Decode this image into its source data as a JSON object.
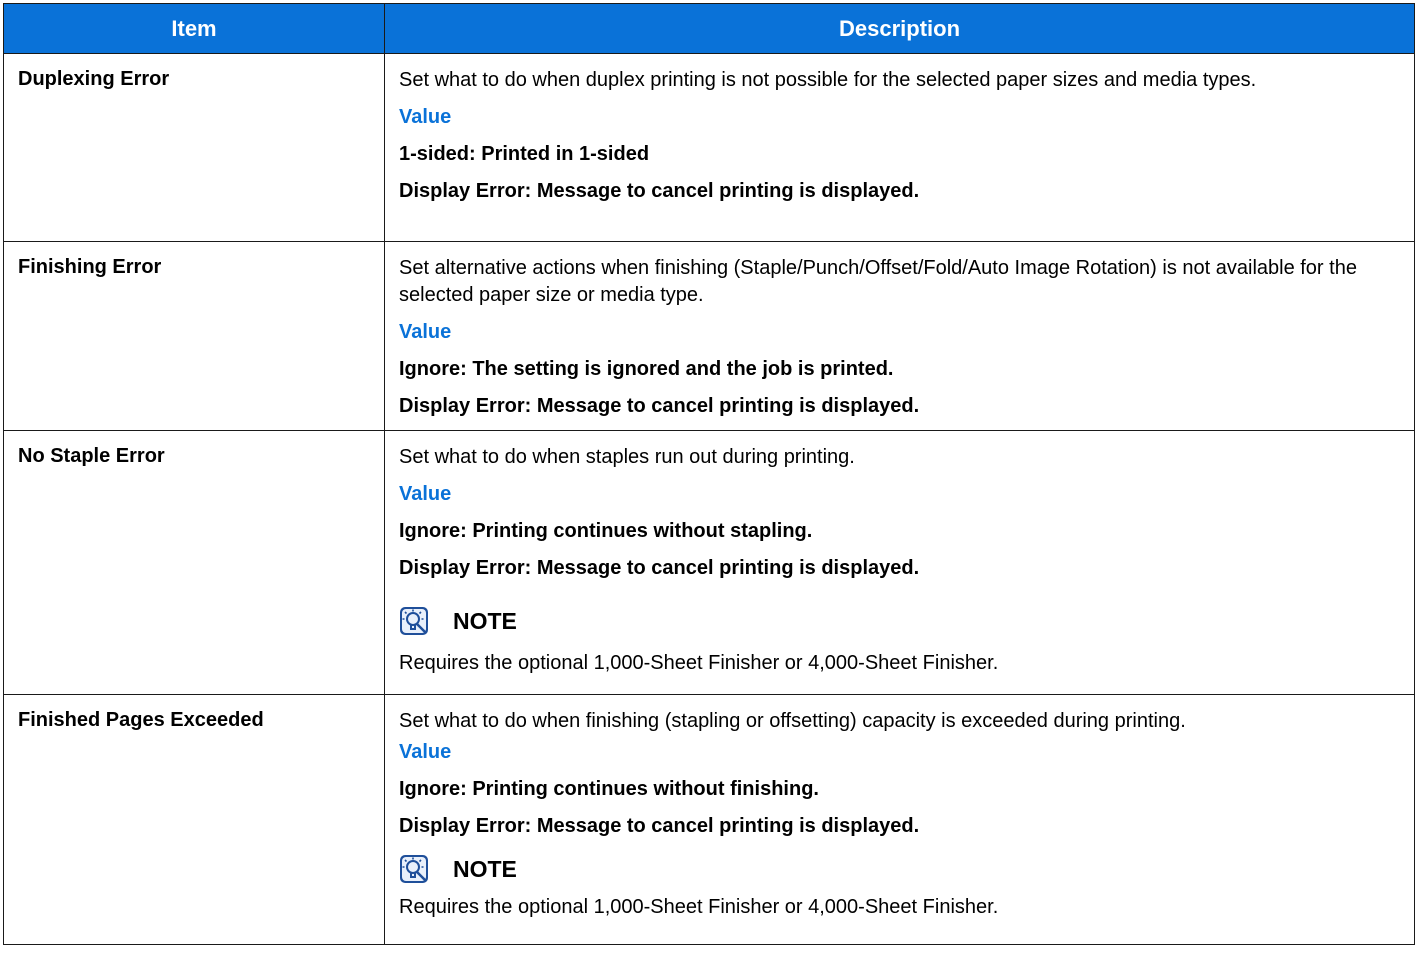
{
  "header": {
    "item": "Item",
    "description": "Description"
  },
  "rows": [
    {
      "item": "Duplexing Error",
      "text": "Set what to do when duplex printing is not possible for the selected paper sizes and media types.",
      "value_heading": "Value",
      "options": [
        "1-sided: Printed in 1-sided",
        "Display Error: Message to cancel printing is displayed."
      ]
    },
    {
      "item": "Finishing Error",
      "text": "Set alternative actions when finishing (Staple/Punch/Offset/Fold/Auto Image Rotation) is not available for the selected paper size or media type.",
      "value_heading": "Value",
      "options": [
        "Ignore: The setting is ignored and the job is printed.",
        "Display Error: Message to cancel printing is displayed."
      ]
    },
    {
      "item": "No Staple Error",
      "text": "Set what to do when staples run out during printing.",
      "value_heading": "Value",
      "options": [
        "Ignore: Printing continues without stapling.",
        "Display Error: Message to cancel printing is displayed."
      ],
      "note_label": "NOTE",
      "note_text": "Requires the optional 1,000-Sheet Finisher or 4,000-Sheet Finisher."
    },
    {
      "item": "Finished Pages Exceeded",
      "text": "Set what to do when finishing (stapling or offsetting) capacity is exceeded during printing.",
      "value_heading": "Value",
      "options": [
        "Ignore: Printing continues without finishing.",
        "Display Error: Message to cancel printing is displayed."
      ],
      "note_label": "NOTE",
      "note_text": "Requires the optional 1,000-Sheet Finisher or 4,000-Sheet Finisher."
    }
  ],
  "colors": {
    "header_bg": "#0a72d8",
    "value_heading": "#0a72d8",
    "border": "#1a1a1a"
  },
  "icons": {
    "note": "note-lightbulb-icon"
  }
}
